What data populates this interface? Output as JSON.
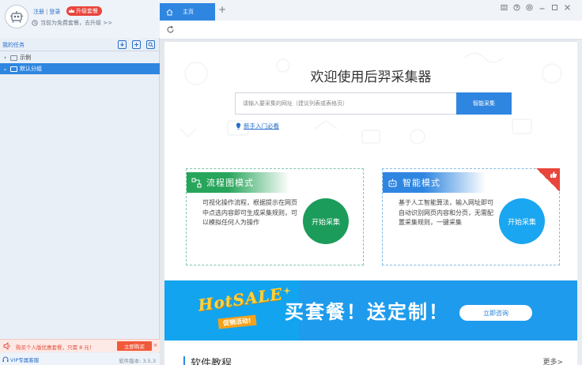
{
  "user": {
    "register": "注册",
    "login": "登录",
    "upgrade_badge": "升级套餐",
    "status": "当前为免费套餐，去升级 >>"
  },
  "tasks": {
    "header": "我的任务",
    "tree": [
      {
        "label": "示例",
        "selected": false,
        "expanded": false
      },
      {
        "label": "默认分组",
        "selected": true,
        "expanded": true
      }
    ]
  },
  "promo_bar": {
    "text": "购买个人版优惠套餐，只需 8 元！",
    "button": "立即购买",
    "close": "×"
  },
  "footer": {
    "vip": "VIP专属客服",
    "version": "软件版本: 3.5.3"
  },
  "tabs": [
    {
      "label": "主页",
      "active": true
    }
  ],
  "tab_add": "+",
  "main": {
    "welcome": "欢迎使用后羿采集器",
    "search_placeholder": "请输入要采集的网址（建议列表或表格页）",
    "search_button": "智能采集",
    "newbie_link": "新手入门必看",
    "flow_mode": {
      "title": "流程图模式",
      "desc": "可视化操作流程，根据提示在网页中点选内容即可生成采集规则，可以模拟任何人为操作",
      "button": "开始采集"
    },
    "smart_mode": {
      "title": "智能模式",
      "desc": "基于人工智能算法，输入网址即可自动识别网页内容和分页，无需配置采集规则，一键采集",
      "button": "开始采集"
    },
    "banner": {
      "hot": "HotSALE",
      "ribbon": "促销活动!",
      "slogan": "买套餐！送定制！",
      "button": "立即咨询"
    },
    "section": {
      "title": "软件教程",
      "more": "更多>"
    }
  },
  "colors": {
    "primary": "#2f86e0",
    "flow_green": "#1c9c5a",
    "smart_blue": "#1aa6f0",
    "red": "#e8453c",
    "banner_bg": "#1e9bec"
  }
}
